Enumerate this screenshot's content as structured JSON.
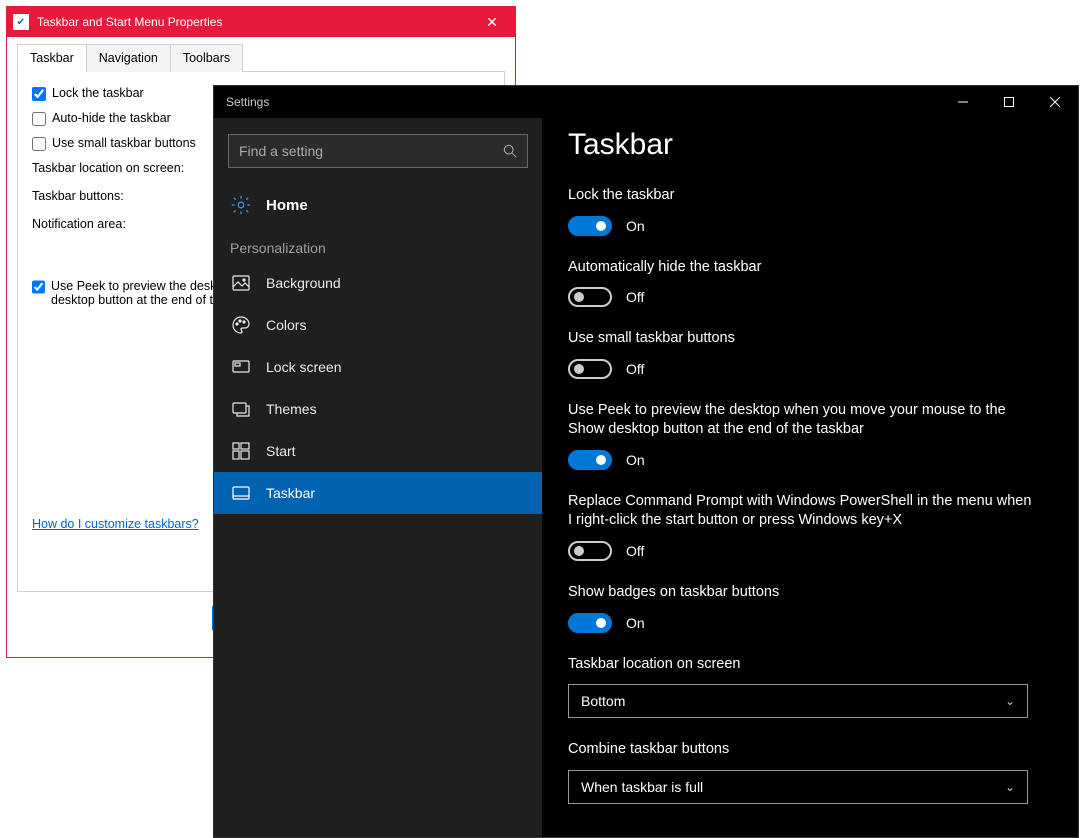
{
  "legacy": {
    "title": "Taskbar and Start Menu Properties",
    "tabs": [
      "Taskbar",
      "Navigation",
      "Toolbars"
    ],
    "active_tab": 0,
    "lock_label": "Lock the taskbar",
    "autohide_label": "Auto-hide the taskbar",
    "smallbtn_label": "Use small taskbar buttons",
    "location_label": "Taskbar location on screen:",
    "buttons_label": "Taskbar buttons:",
    "notif_label": "Notification area:",
    "peek_label": "Use Peek to preview the desktop when you move your mouse to the Show desktop button at the end of the taskbar",
    "help_link": "How do I customize taskbars?"
  },
  "settings": {
    "window_title": "Settings",
    "search_placeholder": "Find a setting",
    "home_label": "Home",
    "section_label": "Personalization",
    "nav": [
      {
        "id": "background",
        "label": "Background"
      },
      {
        "id": "colors",
        "label": "Colors"
      },
      {
        "id": "lockscreen",
        "label": "Lock screen"
      },
      {
        "id": "themes",
        "label": "Themes"
      },
      {
        "id": "start",
        "label": "Start"
      },
      {
        "id": "taskbar",
        "label": "Taskbar"
      }
    ],
    "active_nav": "taskbar",
    "main_title": "Taskbar",
    "toggles": {
      "lock": {
        "label": "Lock the taskbar",
        "on": true,
        "text_on": "On",
        "text_off": "Off"
      },
      "autohide": {
        "label": "Automatically hide the taskbar",
        "on": false,
        "text_on": "On",
        "text_off": "Off"
      },
      "small": {
        "label": "Use small taskbar buttons",
        "on": false,
        "text_on": "On",
        "text_off": "Off"
      },
      "peek": {
        "label": "Use Peek to preview the desktop when you move your mouse to the Show desktop button at the end of the taskbar",
        "on": true,
        "text_on": "On",
        "text_off": "Off"
      },
      "powershell": {
        "label": "Replace Command Prompt with Windows PowerShell in the menu when I right-click the start button or press Windows key+X",
        "on": false,
        "text_on": "On",
        "text_off": "Off"
      },
      "badges": {
        "label": "Show badges on taskbar buttons",
        "on": true,
        "text_on": "On",
        "text_off": "Off"
      }
    },
    "location": {
      "label": "Taskbar location on screen",
      "value": "Bottom"
    },
    "combine": {
      "label": "Combine taskbar buttons",
      "value": "When taskbar is full"
    }
  }
}
